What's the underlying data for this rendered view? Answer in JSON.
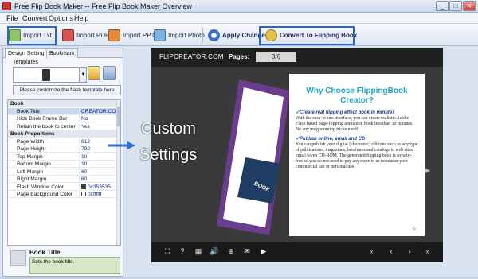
{
  "window": {
    "title": "Free Flip Book Maker -- Free Flip Book Maker Overview",
    "controls": [
      "_",
      "□",
      "✕"
    ]
  },
  "menu": [
    "File",
    "Convert",
    "Options",
    "Help"
  ],
  "toolbar": {
    "import_txt": "Import Txt",
    "import_pdf": "Import PDF",
    "import_ppt": "Import PPT",
    "import_photo": "Import Photo",
    "apply_change": "Apply Change",
    "convert": "Convert To Flipping Book"
  },
  "left_panel": {
    "tabs": [
      "Design Setting",
      "Bookmark"
    ],
    "templates_label": "Templates",
    "customize_button": "Please customize the flash template here",
    "properties": [
      {
        "type": "cat",
        "key": "Book",
        "value": ""
      },
      {
        "type": "row",
        "key": "Book Title",
        "value": "CREATOR.COM"
      },
      {
        "type": "row",
        "key": "Hide Book Frame Bar",
        "value": "No"
      },
      {
        "type": "row",
        "key": "Retain the book to center",
        "value": "Yes"
      },
      {
        "type": "cat",
        "key": "Book Proportions",
        "value": ""
      },
      {
        "type": "row",
        "key": "Page Width",
        "value": "612"
      },
      {
        "type": "row",
        "key": "Page Height",
        "value": "792"
      },
      {
        "type": "row",
        "key": "Top Margin",
        "value": "10"
      },
      {
        "type": "row",
        "key": "Bottom Margin",
        "value": "10"
      },
      {
        "type": "row",
        "key": "Left Margin",
        "value": "60"
      },
      {
        "type": "row",
        "key": "Right Margin",
        "value": "60"
      },
      {
        "type": "color",
        "key": "Flash Window Color",
        "value": "0x353535",
        "swatch": "#353535"
      },
      {
        "type": "color",
        "key": "Page Background Color",
        "value": "0xffffff",
        "swatch": "#ffffff"
      }
    ],
    "description": {
      "title": "Book Title",
      "text": "Sets the book title."
    }
  },
  "preview": {
    "logo": "FLIPCREATOR.COM",
    "pages_label": "Pages:",
    "page_value": "3/6",
    "left_page_word": "BOOK",
    "article": {
      "heading_1": "Why Choose FlippingBook",
      "heading_2": "Creator?",
      "section1_title": "✓Create real flipping effect book in minutes",
      "section1_body": "With the easy-to-use interface, you can create realistic Adobe Flash based page-flipping animation book less than 10 minutes. No any programming tricks need!",
      "section2_title": "✓Publish online, email and CD",
      "section2_body": "You can publish your digital (electronic) editions such as any type of publications, magazines, brochures and catalogs to web sites, email (even CD-ROM. The generated flipping book is royalty-free so you do not need to pay any more to as no matter your commercial use or personal use.",
      "page_number": "-1-"
    },
    "controls": [
      "⛶",
      "?",
      "▦",
      "🔊",
      "⊕",
      "✉",
      "▶",
      "«",
      "‹",
      "›",
      "»"
    ]
  },
  "callout": {
    "line1": "Custom",
    "line2": "Settings"
  },
  "colors": {
    "highlight": "#2a63d6",
    "arrow": "#2f6fd6",
    "accent": "#1fa6c4",
    "cover_purple": "#6a3d8f"
  }
}
